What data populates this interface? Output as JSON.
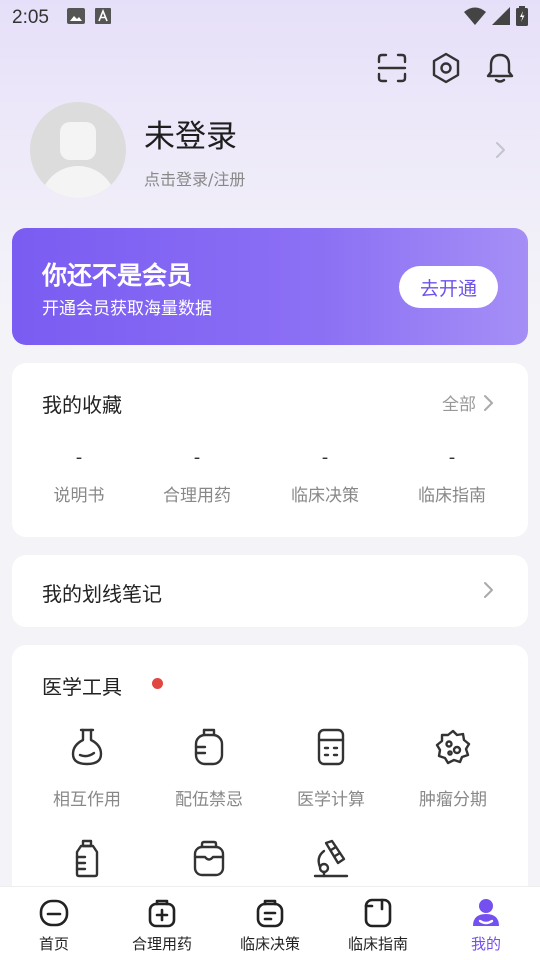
{
  "status_bar": {
    "time": "2:05",
    "left_icons": [
      "image-icon",
      "font-icon"
    ],
    "right_icons": [
      "wifi-icon",
      "signal-icon",
      "battery-icon"
    ]
  },
  "header": {
    "icons": [
      "scan-icon",
      "settings-icon",
      "bell-icon"
    ]
  },
  "profile": {
    "name": "未登录",
    "subtitle": "点击登录/注册"
  },
  "vip": {
    "title": "你还不是会员",
    "subtitle": "开通会员获取海量数据",
    "button_label": "去开通"
  },
  "favorites": {
    "title": "我的收藏",
    "all_label": "全部",
    "items": [
      {
        "value": "-",
        "label": "说明书"
      },
      {
        "value": "-",
        "label": "合理用药"
      },
      {
        "value": "-",
        "label": "临床决策"
      },
      {
        "value": "-",
        "label": "临床指南"
      }
    ]
  },
  "notes": {
    "title": "我的划线笔记"
  },
  "tools": {
    "title": "医学工具",
    "items": [
      {
        "label": "相互作用",
        "icon": "flask-icon"
      },
      {
        "label": "配伍禁忌",
        "icon": "iv-bag-icon"
      },
      {
        "label": "医学计算",
        "icon": "calculator-icon"
      },
      {
        "label": "肿瘤分期",
        "icon": "virus-icon"
      },
      {
        "label": "",
        "icon": "bottle-icon"
      },
      {
        "label": "",
        "icon": "medicine-box-icon"
      },
      {
        "label": "",
        "icon": "microscope-icon"
      }
    ]
  },
  "tab_bar": {
    "active": "我的",
    "accent_color": "#7350ef",
    "tabs": [
      {
        "label": "首页",
        "icon": "home-icon"
      },
      {
        "label": "合理用药",
        "icon": "medical-bag-icon"
      },
      {
        "label": "临床决策",
        "icon": "decision-icon"
      },
      {
        "label": "临床指南",
        "icon": "guide-book-icon"
      },
      {
        "label": "我的",
        "icon": "user-icon"
      }
    ]
  }
}
